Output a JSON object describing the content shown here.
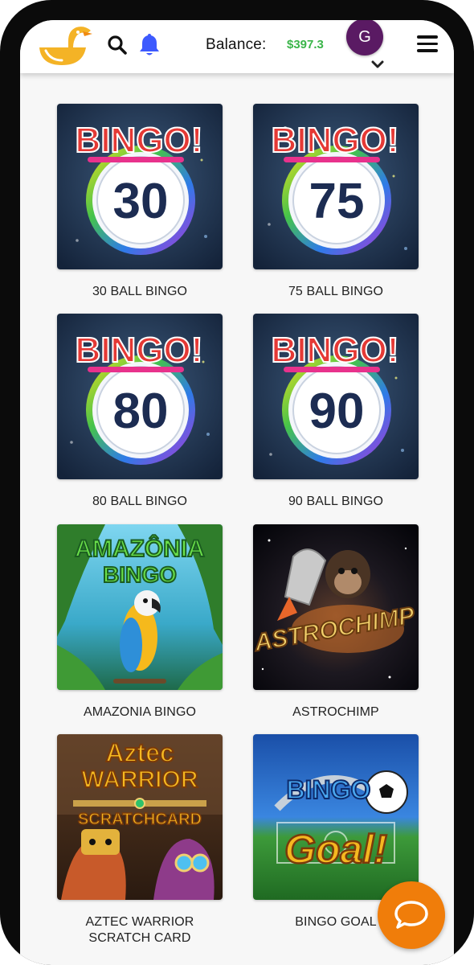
{
  "header": {
    "logo_icon": "duck-logo-icon",
    "search_icon": "search-icon",
    "notification_icon": "bell-icon",
    "balance_label": "Balance:",
    "balance_value": "$397.3",
    "avatar_initial": "G",
    "avatar_color": "#5a1a63",
    "menu_icon": "hamburger-menu-icon"
  },
  "games": [
    {
      "title": "30 BALL BINGO",
      "art_text": [
        "BINGO!",
        "30"
      ]
    },
    {
      "title": "75 BALL BINGO",
      "art_text": [
        "BINGO!",
        "75"
      ]
    },
    {
      "title": "80 BALL BINGO",
      "art_text": [
        "BINGO!",
        "80"
      ]
    },
    {
      "title": "90 BALL BINGO",
      "art_text": [
        "BINGO!",
        "90"
      ]
    },
    {
      "title": "AMAZONIA BINGO",
      "art_text": [
        "AMAZÔNIA",
        "BINGO"
      ]
    },
    {
      "title": "ASTROCHIMP",
      "art_text": [
        "ASTROCHIMP"
      ]
    },
    {
      "title": "AZTEC WARRIOR SCRATCH CARD",
      "art_text": [
        "Aztec",
        "WARRIOR",
        "SCRATCHCARD"
      ]
    },
    {
      "title": "BINGO GOAL",
      "art_text": [
        "BINGO",
        "Goal!"
      ]
    }
  ],
  "chat": {
    "icon": "chat-bubble-icon",
    "color": "#f07d0a"
  },
  "colors": {
    "balance": "#3bb54a",
    "notification": "#3d5afe",
    "screen_bg": "#f7f7f7"
  }
}
